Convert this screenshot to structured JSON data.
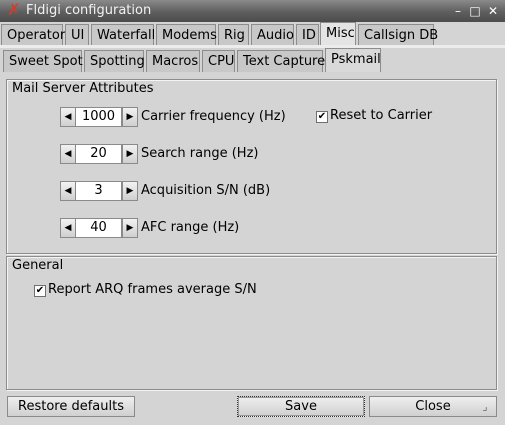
{
  "window": {
    "title": "Fldigi configuration",
    "app_icon": "x-logo-icon",
    "accent": "#d83a2a"
  },
  "tabs_row1": [
    "Operator",
    "UI",
    "Waterfall",
    "Modems",
    "Rig",
    "Audio",
    "ID",
    "Misc",
    "Callsign DB"
  ],
  "tabs_row1_active": "Misc",
  "tabs_row2": [
    "Sweet Spot",
    "Spotting",
    "Macros",
    "CPU",
    "Text Capture",
    "Pskmail"
  ],
  "tabs_row2_active": "Pskmail",
  "mail_server": {
    "label": "Mail Server Attributes",
    "carrier": {
      "value": "1000",
      "label": "Carrier frequency (Hz)"
    },
    "reset_to_carrier": {
      "checked": true,
      "label": "Reset to Carrier"
    },
    "search_range": {
      "value": "20",
      "label": "Search range (Hz)"
    },
    "acquisition": {
      "value": "3",
      "label": "Acquisition S/N (dB)"
    },
    "afc_range": {
      "value": "40",
      "label": "AFC range (Hz)"
    }
  },
  "general": {
    "label": "General",
    "report_arq": {
      "checked": true,
      "label": "Report ARQ frames average S/N"
    }
  },
  "buttons": {
    "restore": "Restore defaults",
    "save": "Save",
    "close": "Close"
  },
  "glyphs": {
    "left": "◀",
    "right": "▶",
    "check": "✔",
    "minimize": "–",
    "maximize": "□",
    "close": "✕"
  }
}
